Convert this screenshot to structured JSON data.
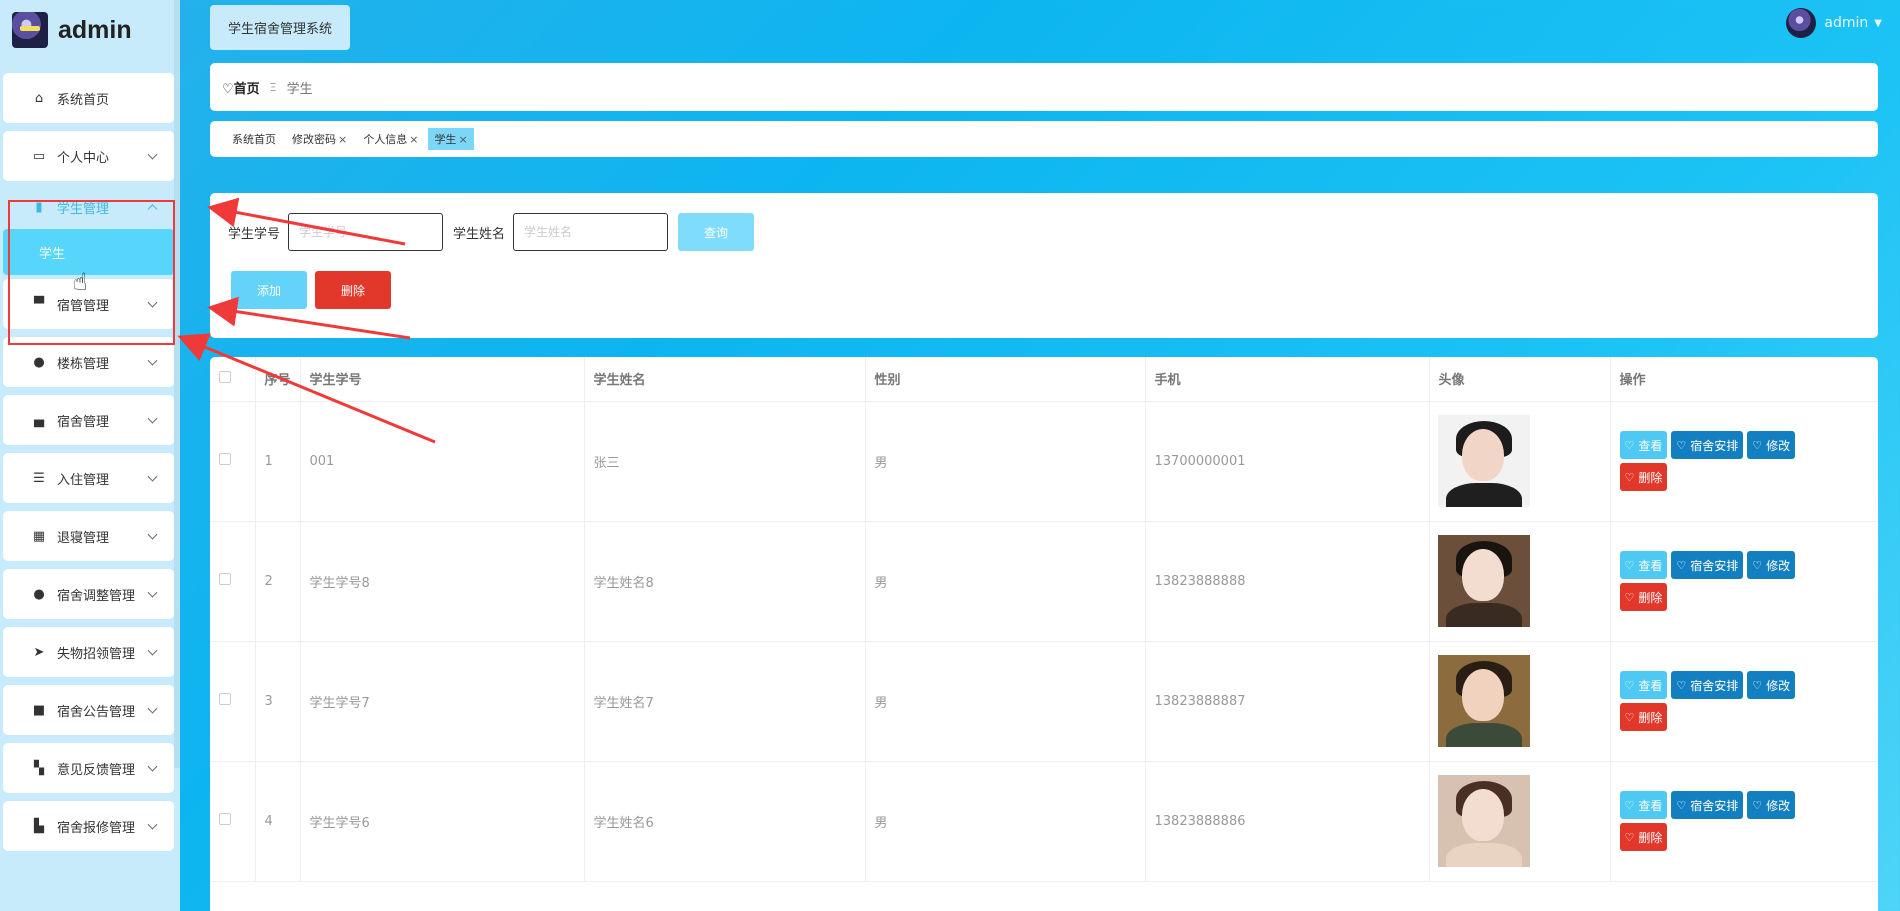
{
  "app": {
    "title": "admin",
    "system_name": "学生宿舍管理系统"
  },
  "user": {
    "name": "admin"
  },
  "sidebar": {
    "items": [
      {
        "label": "系统首页",
        "icon": "home-icon"
      },
      {
        "label": "个人中心",
        "icon": "card-icon"
      },
      {
        "label": "学生管理",
        "icon": "book-icon",
        "open": true,
        "children": [
          {
            "label": "学生"
          }
        ]
      },
      {
        "label": "宿管管理",
        "icon": "brush-icon"
      },
      {
        "label": "楼栋管理",
        "icon": "user-icon"
      },
      {
        "label": "宿舍管理",
        "icon": "printer-icon"
      },
      {
        "label": "入住管理",
        "icon": "list-icon"
      },
      {
        "label": "退寝管理",
        "icon": "grid-icon"
      },
      {
        "label": "宿舍调整管理",
        "icon": "bulb-icon"
      },
      {
        "label": "失物招领管理",
        "icon": "send-icon"
      },
      {
        "label": "宿舍公告管理",
        "icon": "briefcase-icon"
      },
      {
        "label": "意见反馈管理",
        "icon": "apps-icon"
      },
      {
        "label": "宿舍报修管理",
        "icon": "thumb-icon"
      }
    ]
  },
  "breadcrumb": {
    "home": "首页",
    "current": "学生"
  },
  "tags": [
    {
      "label": "系统首页",
      "closable": false
    },
    {
      "label": "修改密码",
      "closable": true
    },
    {
      "label": "个人信息",
      "closable": true
    },
    {
      "label": "学生",
      "closable": true,
      "active": true
    }
  ],
  "search": {
    "id_label": "学生学号",
    "id_placeholder": "学生学号",
    "name_label": "学生姓名",
    "name_placeholder": "学生姓名",
    "query_button": "查询",
    "add_button": "添加",
    "delete_button": "删除"
  },
  "table": {
    "headers": [
      "序号",
      "学生学号",
      "学生姓名",
      "性别",
      "手机",
      "头像",
      "操作"
    ],
    "actions": {
      "view": "查看",
      "assign": "宿舍安排",
      "edit": "修改",
      "delete": "删除"
    },
    "rows": [
      {
        "no": "1",
        "student_id": "001",
        "name": "张三",
        "gender": "男",
        "phone": "13700000001"
      },
      {
        "no": "2",
        "student_id": "学生学号8",
        "name": "学生姓名8",
        "gender": "男",
        "phone": "13823888888"
      },
      {
        "no": "3",
        "student_id": "学生学号7",
        "name": "学生姓名7",
        "gender": "男",
        "phone": "13823888887"
      },
      {
        "no": "4",
        "student_id": "学生学号6",
        "name": "学生姓名6",
        "gender": "男",
        "phone": "13823888886"
      }
    ]
  },
  "colors": {
    "accent": "#55d6fa",
    "danger": "#e1382b",
    "primary_dark": "#127fc1",
    "annotation": "#f03a3a"
  }
}
